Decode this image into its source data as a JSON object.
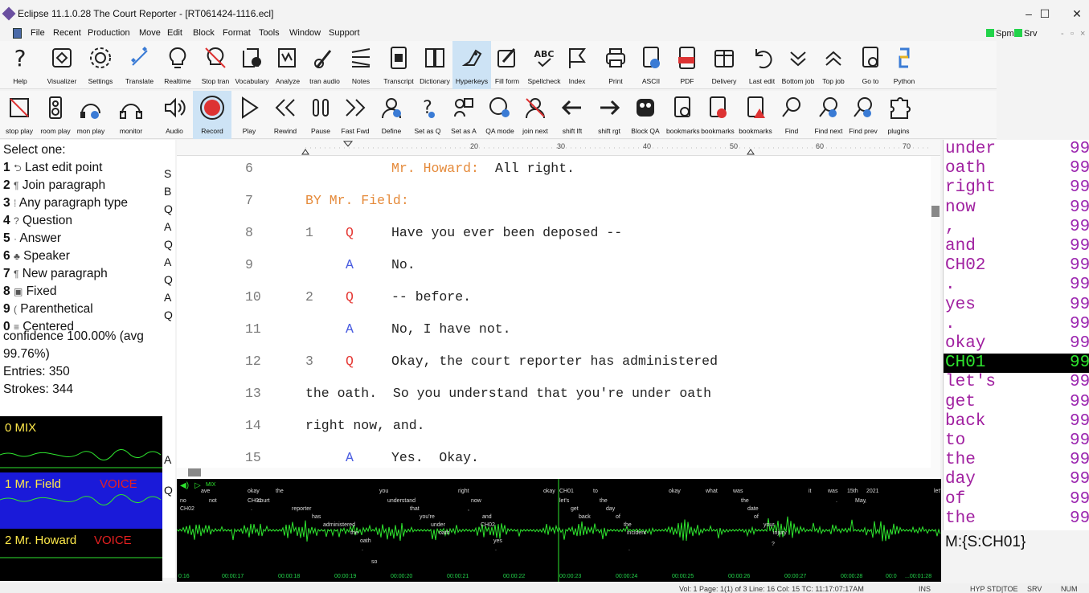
{
  "window": {
    "title": "Eclipse 11.1.0.28 The Court Reporter - [RT061424-1116.ecl]",
    "controls": [
      "–",
      "☐",
      "✕"
    ]
  },
  "menu": {
    "items": [
      "File",
      "Recent",
      "Production",
      "Move",
      "Edit",
      "Block",
      "Format",
      "Tools",
      "Window",
      "Support"
    ],
    "flags": [
      "Spm",
      "Srv"
    ],
    "right_controls": [
      "-",
      "▫",
      "×"
    ]
  },
  "toolbar1": [
    {
      "label": "Help",
      "icon": "help-icon"
    },
    {
      "label": "Visualizer",
      "icon": "visualizer-icon"
    },
    {
      "label": "Settings",
      "icon": "gear-icon"
    },
    {
      "label": "Translate",
      "icon": "translate-icon"
    },
    {
      "label": "Realtime",
      "icon": "lightbulb-icon"
    },
    {
      "label": "Stop tran",
      "icon": "stop-tran-icon"
    },
    {
      "label": "Vocabulary",
      "icon": "vocabulary-icon"
    },
    {
      "label": "Analyze",
      "icon": "analyze-icon"
    },
    {
      "label": "tran audio",
      "icon": "tran-audio-icon"
    },
    {
      "label": "Notes",
      "icon": "notes-icon"
    },
    {
      "label": "Transcript",
      "icon": "transcript-icon"
    },
    {
      "label": "Dictionary",
      "icon": "dictionary-icon"
    },
    {
      "label": "Hyperkeys",
      "icon": "hyperkeys-icon",
      "active": true
    },
    {
      "label": "Fill form",
      "icon": "fill-form-icon"
    },
    {
      "label": "Spellcheck",
      "icon": "spellcheck-icon"
    },
    {
      "label": "Index",
      "icon": "flag-icon"
    },
    {
      "label": "Print",
      "icon": "print-icon"
    },
    {
      "label": "ASCII",
      "icon": "ascii-icon"
    },
    {
      "label": "PDF",
      "icon": "pdf-icon"
    },
    {
      "label": "Delivery",
      "icon": "delivery-icon"
    },
    {
      "label": "Last edit",
      "icon": "undo-icon"
    },
    {
      "label": "Bottom job",
      "icon": "chevron-down-icon"
    },
    {
      "label": "Top job",
      "icon": "chevron-up-icon"
    },
    {
      "label": "Go to",
      "icon": "goto-icon"
    },
    {
      "label": "Python",
      "icon": "python-icon"
    }
  ],
  "toolbar2": [
    {
      "label": "stop play",
      "icon": "stop-play-icon"
    },
    {
      "label": "room play",
      "icon": "room-play-icon"
    },
    {
      "label": "mon play",
      "icon": "mon-play-icon"
    },
    {
      "label": "monitor",
      "icon": "headphones-icon"
    },
    {
      "label": "Audio",
      "icon": "speaker-icon"
    },
    {
      "label": "Record",
      "icon": "record-icon",
      "active": true
    },
    {
      "label": "Play",
      "icon": "play-icon"
    },
    {
      "label": "Rewind",
      "icon": "rewind-icon"
    },
    {
      "label": "Pause",
      "icon": "pause-icon"
    },
    {
      "label": "Fast Fwd",
      "icon": "fast-forward-icon"
    },
    {
      "label": "Define",
      "icon": "define-icon"
    },
    {
      "label": "Set as Q",
      "icon": "set-as-q-icon"
    },
    {
      "label": "Set as A",
      "icon": "set-as-a-icon"
    },
    {
      "label": "QA mode",
      "icon": "qa-mode-icon"
    },
    {
      "label": "join next",
      "icon": "join-next-icon"
    },
    {
      "label": "shift lft",
      "icon": "arrow-left-icon"
    },
    {
      "label": "shift rgt",
      "icon": "arrow-right-icon"
    },
    {
      "label": "Block QA",
      "icon": "block-qa-icon"
    },
    {
      "label": "bookmarks",
      "icon": "bookmarks-icon"
    },
    {
      "label": "bookmarks",
      "icon": "bookmark-add-icon"
    },
    {
      "label": "bookmarks",
      "icon": "bookmark-warning-icon"
    },
    {
      "label": "Find",
      "icon": "search-icon"
    },
    {
      "label": "Find next",
      "icon": "find-next-icon"
    },
    {
      "label": "Find prev",
      "icon": "find-prev-icon"
    },
    {
      "label": "plugins",
      "icon": "plugins-icon"
    }
  ],
  "left_panel": {
    "header": "Select one:",
    "options": [
      {
        "key": "1",
        "glyph": "⮌",
        "label": "Last edit point",
        "side": "S"
      },
      {
        "key": "2",
        "glyph": "¶",
        "label": "Join paragraph",
        "side": "B"
      },
      {
        "key": "3",
        "glyph": "⁞",
        "label": "Any paragraph type",
        "side": "Q"
      },
      {
        "key": "4",
        "glyph": "?",
        "label": "Question",
        "side": "A"
      },
      {
        "key": "5",
        "glyph": "·",
        "label": "Answer",
        "side": "Q"
      },
      {
        "key": "6",
        "glyph": "♣",
        "label": "Speaker",
        "side": "A"
      },
      {
        "key": "7",
        "glyph": "¶",
        "label": "New paragraph",
        "side": "Q"
      },
      {
        "key": "8",
        "glyph": "▣",
        "label": "Fixed",
        "side": "A"
      },
      {
        "key": "9",
        "glyph": "(",
        "label": "Parenthetical",
        "side": "Q"
      },
      {
        "key": "0",
        "glyph": "≡",
        "label": "Centered",
        "side": ""
      }
    ],
    "confidence": "confidence 100.00% (avg",
    "avg": "99.76%)",
    "entries": "Entries: 350",
    "strokes": "Strokes: 344",
    "mixer_side": [
      "A",
      "Q"
    ]
  },
  "mixer": [
    {
      "name": "0  MIX",
      "tag": ""
    },
    {
      "name": "1  Mr. Field",
      "tag": "VOICE"
    },
    {
      "name": "2  Mr. Howard",
      "tag": "VOICE"
    }
  ],
  "ruler": {
    "marks": [
      "20",
      "30",
      "40",
      "50",
      "60",
      "70"
    ]
  },
  "transcript": [
    {
      "ln": "6",
      "qn": "",
      "qa": "",
      "speaker": "Mr. Howard:",
      "text": "All right."
    },
    {
      "ln": "7",
      "qn": "",
      "qa": "",
      "speaker": "BY Mr. Field:",
      "text": ""
    },
    {
      "ln": "8",
      "qn": "1",
      "qa": "Q",
      "speaker": "",
      "text": "Have you ever been deposed --"
    },
    {
      "ln": "9",
      "qn": "",
      "qa": "A",
      "speaker": "",
      "text": "No."
    },
    {
      "ln": "10",
      "qn": "2",
      "qa": "Q",
      "speaker": "",
      "text": "-- before."
    },
    {
      "ln": "11",
      "qn": "",
      "qa": "A",
      "speaker": "",
      "text": "No, I have not."
    },
    {
      "ln": "12",
      "qn": "3",
      "qa": "Q",
      "speaker": "",
      "text": "Okay, the court reporter has administered"
    },
    {
      "ln": "13",
      "qn": "",
      "qa": "",
      "speaker": "",
      "text": "the oath.  So you understand that you're under oath"
    },
    {
      "ln": "14",
      "qn": "",
      "qa": "",
      "speaker": "",
      "text": "right now, and."
    },
    {
      "ln": "15",
      "qn": "",
      "qa": "A",
      "speaker": "",
      "text": "Yes.  Okay."
    }
  ],
  "waveform": {
    "header_icons": [
      "speaker-icon",
      "play-icon"
    ],
    "header_text": "MIX",
    "words": [
      "ave",
      "no",
      "CH02",
      "okay",
      "not",
      "the",
      "CH01",
      "court",
      ".",
      "reporter",
      "has",
      "administered",
      "the",
      "oath",
      ".",
      "so",
      "you",
      "understand",
      "that",
      "you're",
      "under",
      "oath",
      "right",
      "now",
      ",",
      "and",
      "CH02",
      "yes",
      ".",
      "okay",
      "CH01",
      "let's",
      "get",
      "back",
      "to",
      "the",
      "day",
      "of",
      "the",
      "incident",
      ".",
      "okay",
      "what",
      "was",
      "the",
      "date",
      "of",
      "your",
      "injury",
      "?",
      "it",
      "was",
      "15th",
      "2021",
      "May",
      ".",
      ",",
      "let's"
    ],
    "timestamps": [
      "0:16",
      "00:00:17",
      "00:00:18",
      "00:00:19",
      "00:00:20",
      "00:00:21",
      "00:00:22",
      "00:00:23",
      "00:00:24",
      "00:00:25",
      "00:00:26",
      "00:00:27",
      "00:00:28",
      "00:0",
      "...00:01:28"
    ]
  },
  "wordlist": {
    "rows": [
      {
        "word": "under",
        "score": "99"
      },
      {
        "word": "oath",
        "score": "99"
      },
      {
        "word": "right",
        "score": "99"
      },
      {
        "word": "now",
        "score": "99"
      },
      {
        "word": ",",
        "score": "99"
      },
      {
        "word": "and",
        "score": "99"
      },
      {
        "word": "CH02",
        "score": "99"
      },
      {
        "word": ".",
        "score": "99"
      },
      {
        "word": "yes",
        "score": "99"
      },
      {
        "word": ".",
        "score": "99"
      },
      {
        "word": "okay",
        "score": "99"
      },
      {
        "word": "CH01",
        "score": "99",
        "selected": true
      },
      {
        "word": "let's",
        "score": "99"
      },
      {
        "word": "get",
        "score": "99"
      },
      {
        "word": "back",
        "score": "99"
      },
      {
        "word": "to",
        "score": "99"
      },
      {
        "word": "the",
        "score": "99"
      },
      {
        "word": "day",
        "score": "99"
      },
      {
        "word": "of",
        "score": "99"
      },
      {
        "word": "the",
        "score": "99"
      }
    ],
    "status": "M:{S:CH01}"
  },
  "statusbar": {
    "position": "Vol: 1  Page: 1(1) of 3  Line: 16  Col: 15  TC: 11:17:07:17AM",
    "ins": "INS",
    "hyp": "HYP STD|TOE",
    "srv": "SRV",
    "num": "NUM"
  },
  "colors": {
    "accent": "#cde3f5",
    "speaker": "#e58a3a",
    "question": "#e53935",
    "answer": "#4a5de0",
    "wordlist": "#a020a0",
    "wave": "#2ee52e",
    "mixer_sel": "#1a1ad9"
  }
}
